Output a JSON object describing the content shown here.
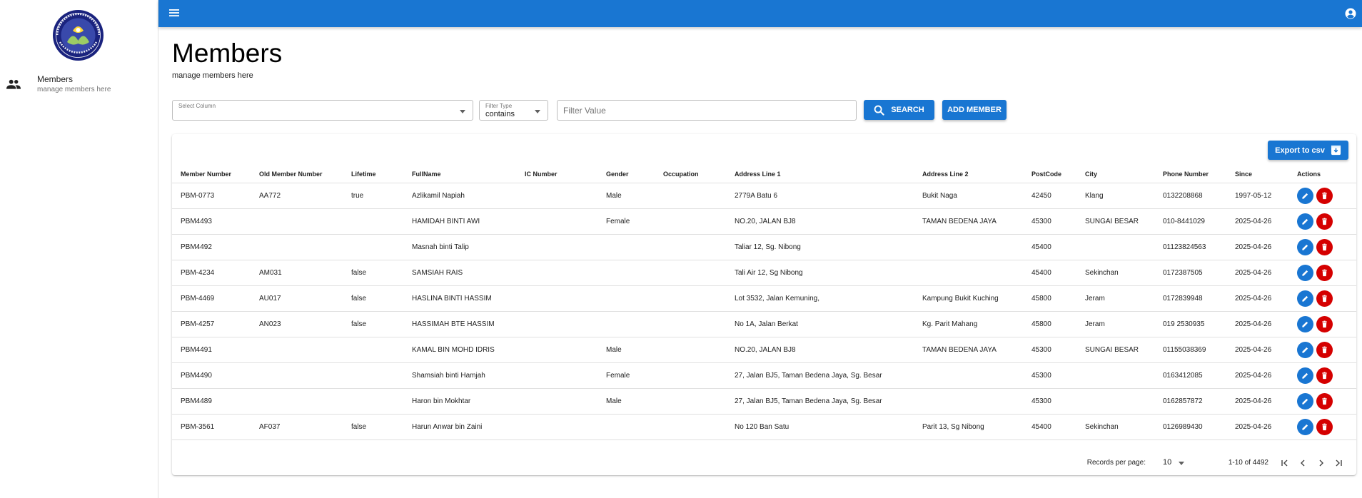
{
  "sidebar": {
    "logo_text": "PERTUBUHAN BANJAR MALAYSIA",
    "items": [
      {
        "label": "Members",
        "sublabel": "manage members here",
        "icon": "people-icon"
      }
    ]
  },
  "appbar": {
    "menu_icon": "hamburger-menu-icon",
    "account_icon": "account-circle-icon",
    "color": "#1976d2"
  },
  "page": {
    "title": "Members",
    "subtitle": "manage members here"
  },
  "filters": {
    "column": {
      "label": "Select Column",
      "value": ""
    },
    "type": {
      "label": "Filter Type",
      "value": "contains"
    },
    "value": {
      "placeholder": "Filter Value",
      "value": ""
    },
    "search_label": "SEARCH",
    "add_label": "ADD MEMBER"
  },
  "table": {
    "export_label": "Export to csv",
    "columns": [
      "Member Number",
      "Old Member Number",
      "Lifetime",
      "FullName",
      "IC Number",
      "Gender",
      "Occupation",
      "Address Line 1",
      "Address Line 2",
      "PostCode",
      "City",
      "Phone Number",
      "Since",
      "Actions"
    ],
    "rows": [
      [
        "PBM-0773",
        "AA772",
        "true",
        "Azlikamil Napiah",
        "",
        "Male",
        "",
        "2779A Batu 6",
        "Bukit Naga",
        "42450",
        "Klang",
        "0132208868",
        "1997-05-12"
      ],
      [
        "PBM4493",
        "",
        "",
        "HAMIDAH BINTI AWI",
        "",
        "Female",
        "",
        "NO.20, JALAN BJ8",
        "TAMAN BEDENA JAYA",
        "45300",
        "SUNGAI BESAR",
        "010-8441029",
        "2025-04-26"
      ],
      [
        "PBM4492",
        "",
        "",
        "Masnah binti Talip",
        "",
        "",
        "",
        "Taliar 12, Sg. Nibong",
        "",
        "45400",
        "",
        "01123824563",
        "2025-04-26"
      ],
      [
        "PBM-4234",
        "AM031",
        "false",
        "SAMSIAH RAIS",
        "",
        "",
        "",
        "Tali Air 12, Sg Nibong",
        "",
        "45400",
        "Sekinchan",
        "0172387505",
        "2025-04-26"
      ],
      [
        "PBM-4469",
        "AU017",
        "false",
        "HASLINA BINTI HASSIM",
        "",
        "",
        "",
        "Lot 3532, Jalan Kemuning,",
        "Kampung Bukit Kuching",
        "45800",
        "Jeram",
        "0172839948",
        "2025-04-26"
      ],
      [
        "PBM-4257",
        "AN023",
        "false",
        "HASSIMAH BTE HASSIM",
        "",
        "",
        "",
        "No 1A, Jalan Berkat",
        "Kg. Parit Mahang",
        "45800",
        "Jeram",
        "019 2530935",
        "2025-04-26"
      ],
      [
        "PBM4491",
        "",
        "",
        "KAMAL BIN MOHD IDRIS",
        "",
        "Male",
        "",
        "NO.20, JALAN BJ8",
        "TAMAN BEDENA JAYA",
        "45300",
        "SUNGAI BESAR",
        "01155038369",
        "2025-04-26"
      ],
      [
        "PBM4490",
        "",
        "",
        "Shamsiah binti Hamjah",
        "",
        "Female",
        "",
        "27, Jalan BJ5, Taman Bedena Jaya, Sg. Besar",
        "",
        "45300",
        "",
        "0163412085",
        "2025-04-26"
      ],
      [
        "PBM4489",
        "",
        "",
        "Haron bin Mokhtar",
        "",
        "Male",
        "",
        "27, Jalan BJ5, Taman Bedena Jaya, Sg. Besar",
        "",
        "45300",
        "",
        "0162857872",
        "2025-04-26"
      ],
      [
        "PBM-3561",
        "AF037",
        "false",
        "Harun Anwar bin Zaini",
        "",
        "",
        "",
        "No 120 Ban Satu",
        "Parit 13, Sg Nibong",
        "45400",
        "Sekinchan",
        "0126989430",
        "2025-04-26"
      ]
    ],
    "action_icons": [
      "pencil-icon",
      "trash-icon"
    ],
    "edit_color": "#1976d2",
    "delete_color": "#d50000"
  },
  "pagination": {
    "rows_per_page_label": "Records per page:",
    "rows_per_page": "10",
    "range": "1-10 of 4492",
    "icons": [
      "first-page-icon",
      "prev-page-icon",
      "next-page-icon",
      "last-page-icon"
    ]
  }
}
